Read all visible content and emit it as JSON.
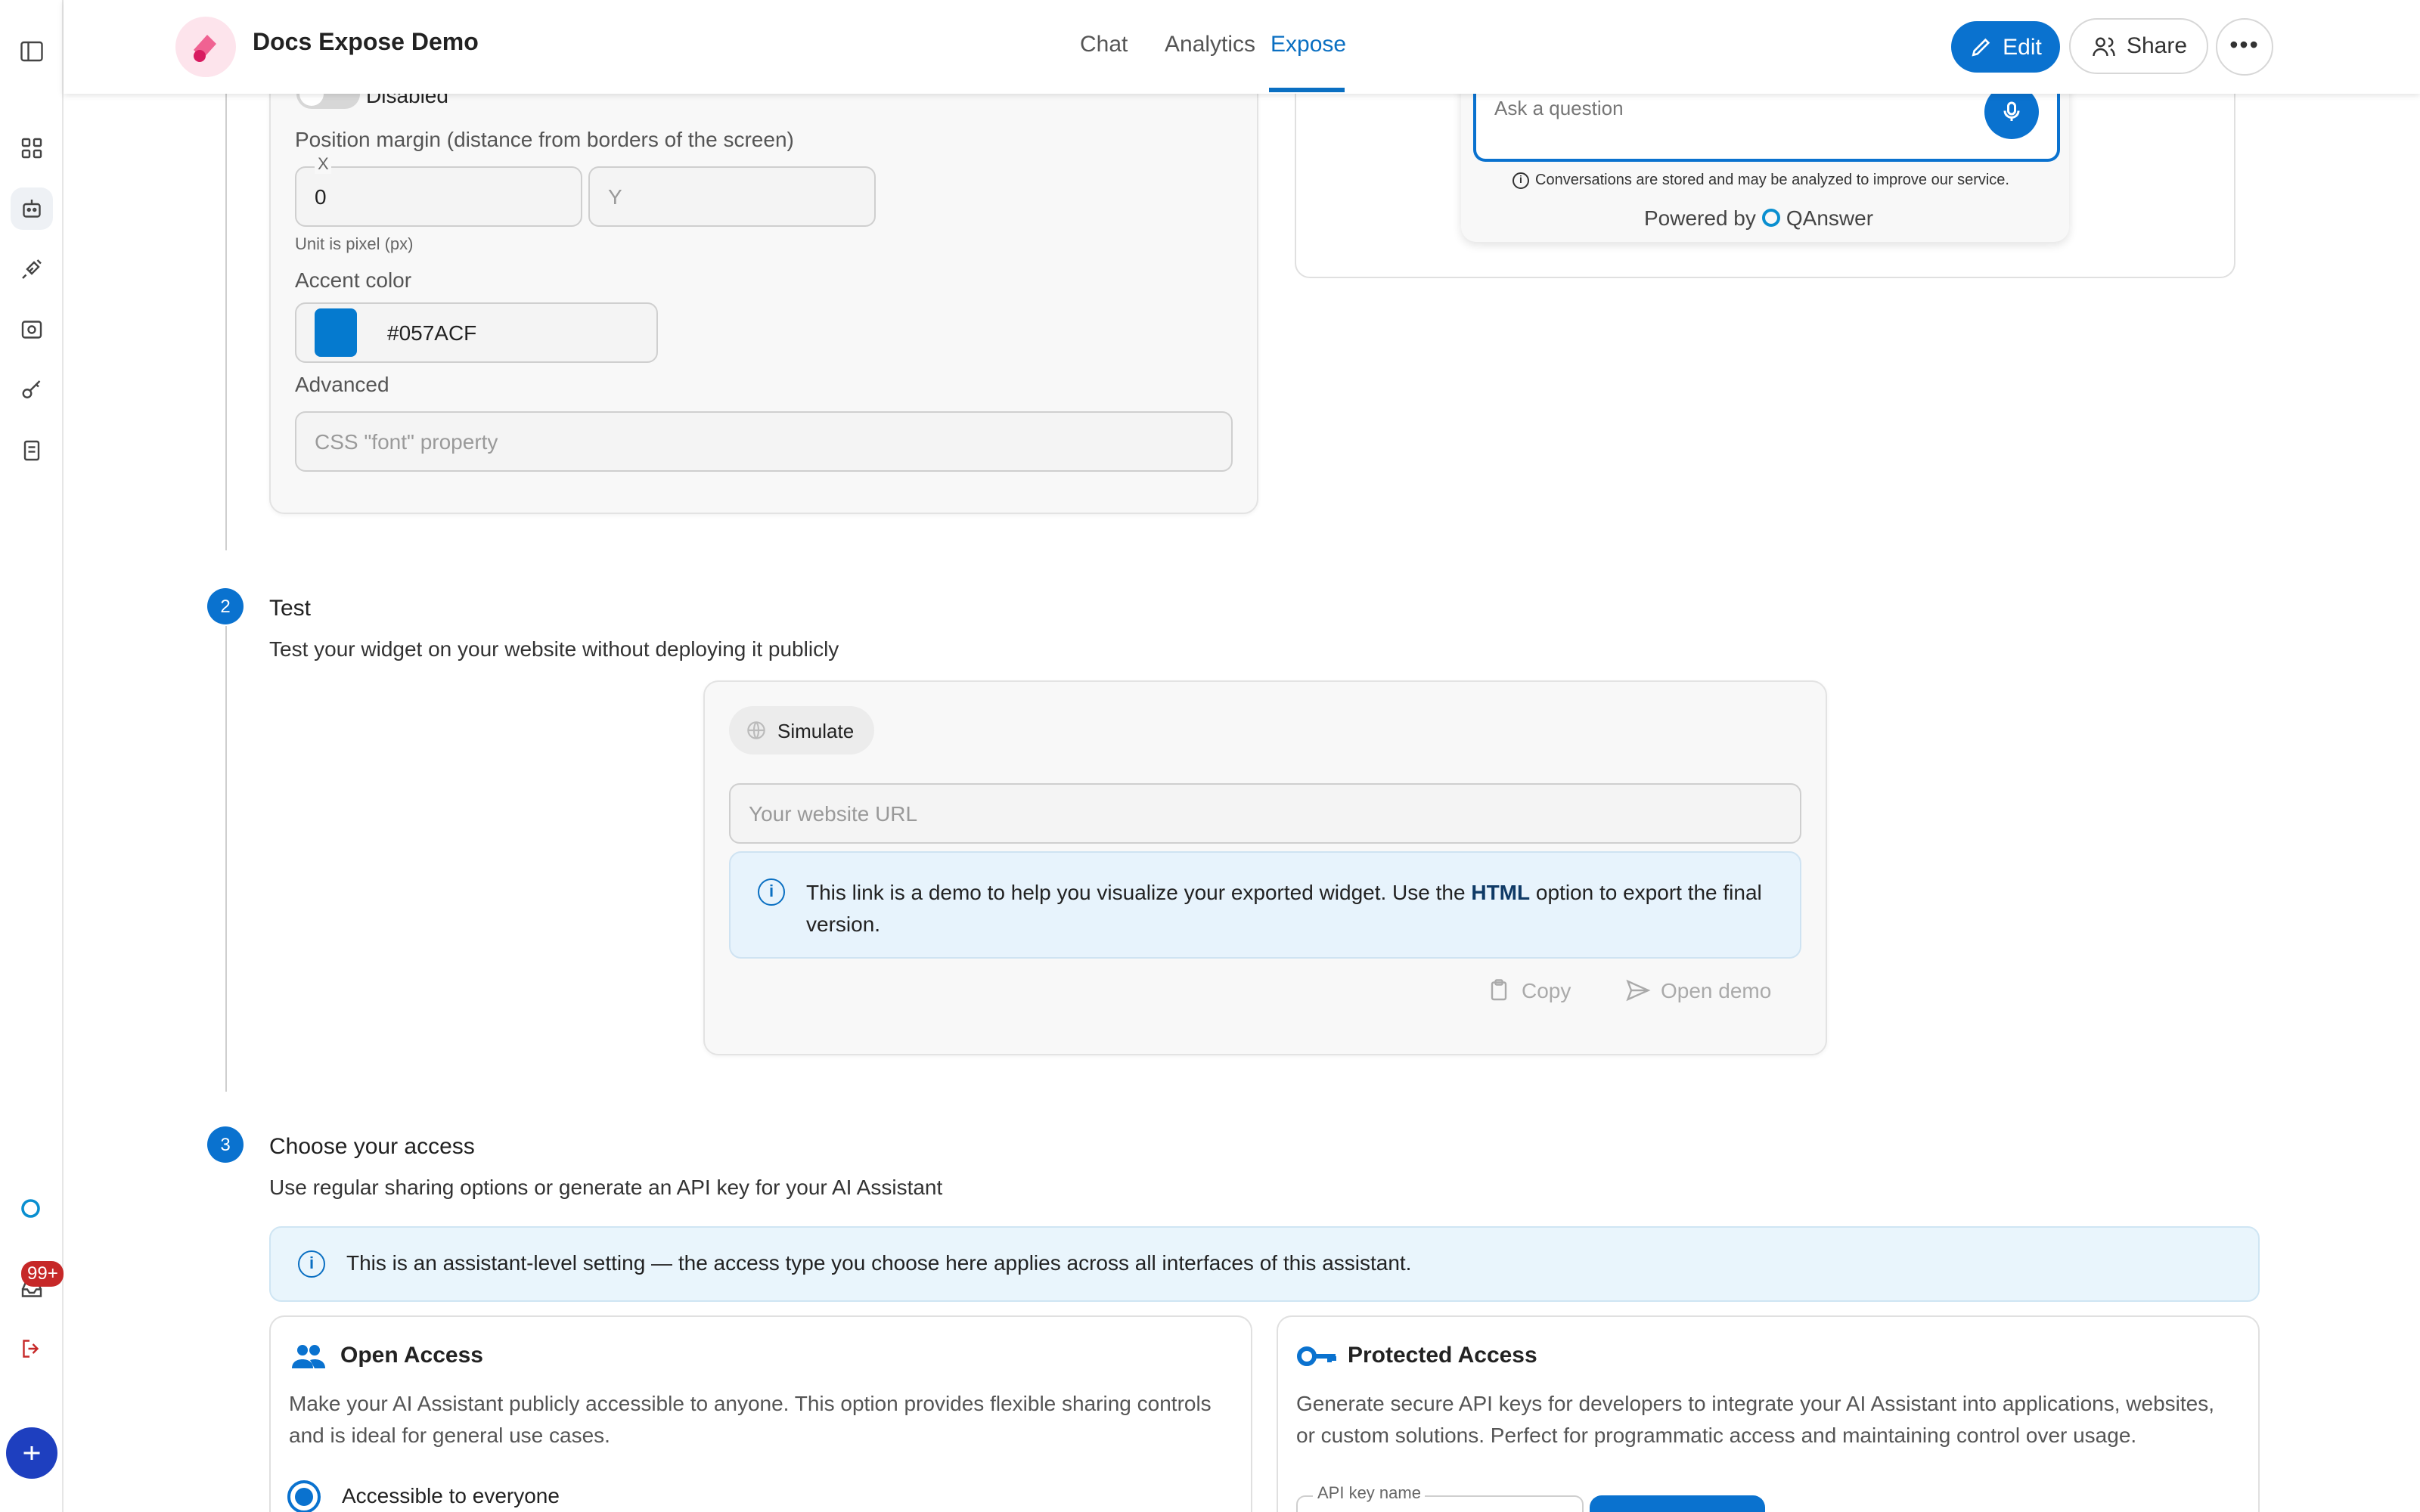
{
  "app": {
    "title": "Docs Expose Demo"
  },
  "nav": {
    "chat": "Chat",
    "analytics": "Analytics",
    "expose": "Expose"
  },
  "header_actions": {
    "edit": "Edit",
    "share": "Share"
  },
  "rail": {
    "badge": "99+"
  },
  "config": {
    "toggle_label": "Disabled",
    "margin_label": "Position margin (distance from borders of the screen)",
    "x_label": "X",
    "x_value": "0",
    "y_placeholder": "Y",
    "unit_hint": "Unit is pixel (px)",
    "accent_label": "Accent color",
    "accent_value": "#057ACF",
    "advanced_label": "Advanced",
    "font_placeholder": "CSS \"font\" property"
  },
  "preview": {
    "ask_placeholder": "Ask a question",
    "notice": "Conversations are stored and may be analyzed to improve our service.",
    "powered_by": "Powered by",
    "brand": "QAnswer"
  },
  "step2": {
    "number": "2",
    "title": "Test",
    "description": "Test your widget on your website without deploying it publicly",
    "simulate": "Simulate",
    "url_placeholder": "Your website URL",
    "info_pre": "This link is a demo to help you visualize your exported widget. Use the ",
    "info_bold": "HTML",
    "info_post": " option to export the final version.",
    "copy": "Copy",
    "open_demo": "Open demo"
  },
  "step3": {
    "number": "3",
    "title": "Choose your access",
    "description": "Use regular sharing options or generate an API key for your AI Assistant",
    "info": "This is an assistant-level setting — the access type you choose here applies across all interfaces of this assistant.",
    "open_title": "Open Access",
    "open_desc": "Make your AI Assistant publicly accessible to anyone. This option provides flexible sharing controls and is ideal for general use cases.",
    "open_radio": "Accessible to everyone",
    "protected_title": "Protected Access",
    "protected_desc": "Generate secure API keys for developers to integrate your AI Assistant into applications, websites, or custom solutions. Perfect for programmatic access and maintaining control over usage.",
    "api_key_label": "API key name"
  },
  "colors": {
    "accent": "#057ACF",
    "primary": "#0A72CF",
    "info_bg": "#E7F3FC"
  }
}
